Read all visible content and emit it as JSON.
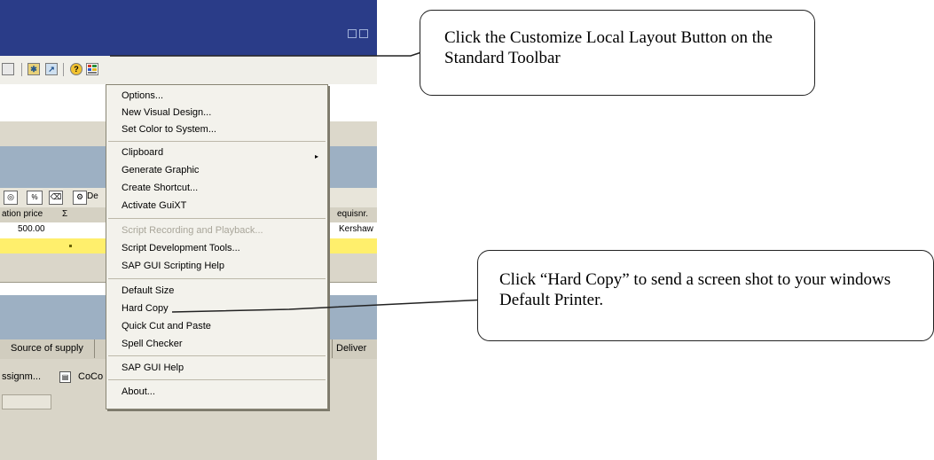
{
  "toolbar": {
    "icons": [
      "save-icon",
      "layout-icon",
      "generate-shortcut-icon",
      "help-icon",
      "customize-local-layout-icon"
    ]
  },
  "grid": {
    "toolbar_button": "De",
    "headers": {
      "price": "ation price",
      "sigma": "Σ",
      "requisitioner": "equisnr."
    },
    "row1": {
      "price": "500.00",
      "requisitioner": "Kershaw"
    }
  },
  "tabs": {
    "source_of_supply": "Source of supply",
    "delivery": "Deliver"
  },
  "bottom": {
    "assignment": "ssignm...",
    "company_code": "CoCo"
  },
  "menu": {
    "items": [
      {
        "label": "Options...",
        "enabled": true
      },
      {
        "label": "New Visual Design...",
        "enabled": true
      },
      {
        "label": "Set Color to System...",
        "enabled": true
      },
      {
        "label": "Clipboard",
        "enabled": true,
        "has_submenu": true
      },
      {
        "label": "Generate Graphic",
        "enabled": true
      },
      {
        "label": "Create Shortcut...",
        "enabled": true
      },
      {
        "label": "Activate GuiXT",
        "enabled": true
      },
      {
        "label": "Script Recording and Playback...",
        "enabled": false
      },
      {
        "label": "Script Development Tools...",
        "enabled": true
      },
      {
        "label": "SAP GUI Scripting Help",
        "enabled": true
      },
      {
        "label": "Default Size",
        "enabled": true
      },
      {
        "label": "Hard Copy",
        "enabled": true
      },
      {
        "label": "Quick Cut and Paste",
        "enabled": true
      },
      {
        "label": "Spell Checker",
        "enabled": true
      },
      {
        "label": "SAP GUI Help",
        "enabled": true
      },
      {
        "label": "About...",
        "enabled": true
      }
    ]
  },
  "callouts": {
    "customize_layout": "Click the Customize Local Layout Button on the Standard Toolbar",
    "hard_copy": "Click “Hard Copy” to send a screen shot to your windows Default Printer."
  }
}
